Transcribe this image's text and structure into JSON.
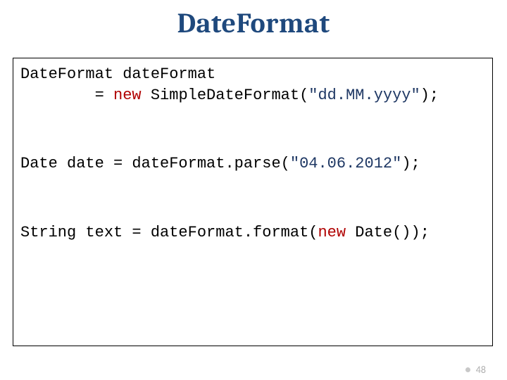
{
  "title": "DateFormat",
  "code": {
    "line1": "DateFormat dateFormat",
    "line2_indent": "        = ",
    "line2_new": "new",
    "line2_rest1": " SimpleDateFormat(",
    "line2_str": "\"dd.MM.yyyy\"",
    "line2_rest2": ");",
    "line3_a": "Date date = dateFormat.parse(",
    "line3_str": "\"04.06.2012\"",
    "line3_b": ");",
    "line4_a": "String text = dateFormat.format(",
    "line4_new": "new",
    "line4_b": " Date());"
  },
  "page_number": "48"
}
